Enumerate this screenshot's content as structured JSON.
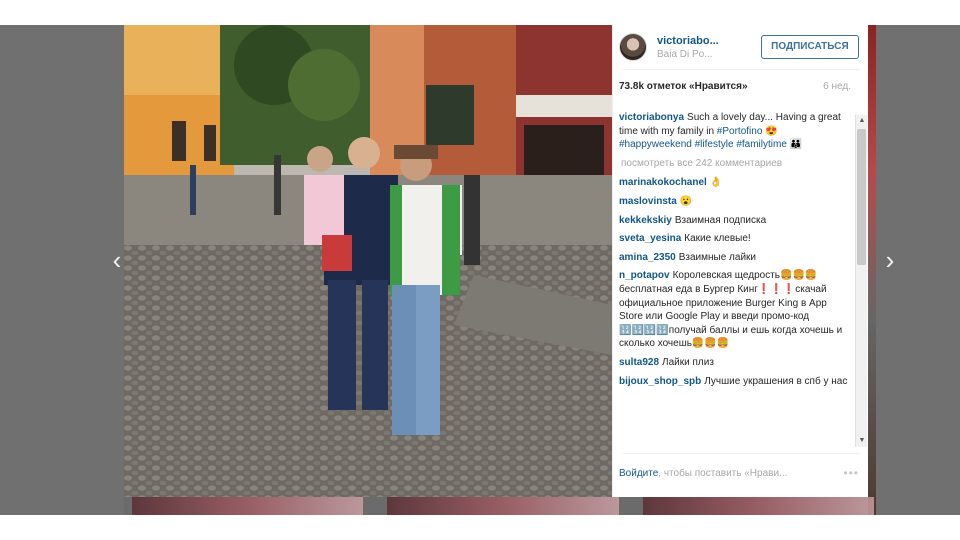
{
  "post": {
    "username": "victoriabo...",
    "location": "Baia Di Po...",
    "follow_label": "ПОДПИСАТЬСЯ",
    "likes": "73.8k отметок «Нравится»",
    "age": "6 нед."
  },
  "caption": {
    "user": "victoriabonya",
    "text": "Such a lovely day... Having a great time with my family in",
    "tag1": "#Portofino",
    "emoji1": "😍",
    "tag2": "#happyweekend",
    "tag3": "#lifestyle",
    "tag4": "#familytime",
    "emoji2": "👪"
  },
  "view_all": "посмотреть все 242 комментариев",
  "comments": [
    {
      "user": "marinakokochanel",
      "text": "👌"
    },
    {
      "user": "maslovinsta",
      "text": "😮"
    },
    {
      "user": "kekkekskiy",
      "text": "Взаимная подписка"
    },
    {
      "user": "sveta_yesina",
      "text": "Какие клевые!"
    },
    {
      "user": "amina_2350",
      "text": "Взаимные лайки"
    },
    {
      "user": "n_potapov",
      "text": "Королевская щедрость🍔🍔🍔бесплатная еда в Бургер Кинг❗❗❗скачай официальное приложение Burger King в App Store или Google Play и введи промо-код 🔢🔢🔢🔢получай баллы и ешь когда хочешь и сколько хочешь🍔🍔🍔"
    },
    {
      "user": "sulta928",
      "text": "Лайки плиз"
    },
    {
      "user": "bijoux_shop_spb",
      "text": "Лучшие украшения в спб у нас"
    }
  ],
  "footer": {
    "login_label": "Войдите",
    "rest_text": ", чтобы поставить «Нрави..."
  },
  "icons": {
    "prev": "chevron-left-icon",
    "next": "chevron-right-icon",
    "more": "more-icon"
  },
  "colors": {
    "link": "#125688",
    "follow": "#3f729b",
    "muted": "#a5a7aa"
  }
}
